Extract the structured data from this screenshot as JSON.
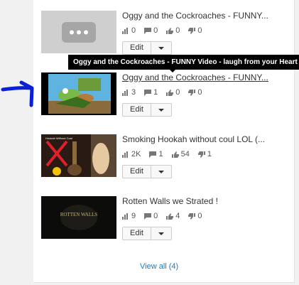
{
  "videos": [
    {
      "title": "Oggy and the Cockroaches - FUNNY...",
      "thumb": "placeholder",
      "views": "0",
      "comments": "0",
      "likes": "0",
      "dislikes": "0",
      "edit_label": "Edit"
    },
    {
      "title": "Oggy and the Cockroaches - FUNNY...",
      "thumb": "cartoon",
      "views": "3",
      "comments": "1",
      "likes": "0",
      "dislikes": "0",
      "edit_label": "Edit"
    },
    {
      "title": "Smoking Hookah without coul LOL (...",
      "thumb": "hookah",
      "thumb_caption": "Hookah Without Coal",
      "views": "2K",
      "comments": "1",
      "likes": "54",
      "dislikes": "1",
      "edit_label": "Edit"
    },
    {
      "title": "Rotten Walls we Strated !",
      "thumb": "rotten",
      "thumb_caption": "ROTTEN WALLS",
      "views": "9",
      "comments": "0",
      "likes": "4",
      "dislikes": "0",
      "edit_label": "Edit"
    }
  ],
  "tooltip": "Oggy and the Cockroaches - FUNNY Video - laugh from your Heart",
  "view_all": "View all (4)",
  "colors": {
    "link": "#167ac6",
    "annotation": "#0a1fd6"
  }
}
